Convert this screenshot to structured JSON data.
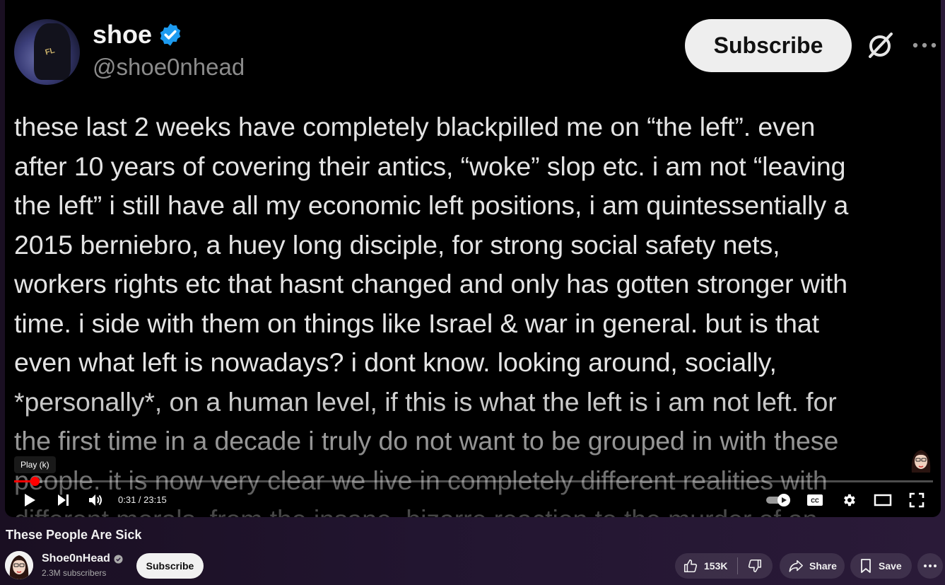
{
  "tweet": {
    "display_name": "shoe",
    "handle": "@shoe0nhead",
    "subscribe_label": "Subscribe",
    "lines": [
      "these last 2 weeks have completely blackpilled me on “the left”. even",
      "after 10 years of covering their antics, “woke” slop etc. i am not “leaving",
      "the left” i still have all my economic left positions, i am quintessentially a",
      "2015 berniebro, a huey long disciple, for strong social safety nets,",
      "workers rights etc that hasnt changed and only has gotten stronger with",
      "time. i side with them on things like Israel & war in general. but is that",
      "even what left is nowadays? i dont know. looking around, socially,",
      "*personally*, on a human level, if this is what the left is i am not left. for",
      "the first time in a decade i truly do not want to be grouped in with these",
      "people. it is now very clear we live in completely different realities with",
      "different morals, from the insane, bizarre reaction to the murder of an"
    ]
  },
  "player": {
    "tooltip": "Play (k)",
    "time_display": "0:31 / 23:15",
    "progress_fraction": 0.022
  },
  "video": {
    "title": "These People Are Sick"
  },
  "channel": {
    "name": "Shoe0nHead",
    "subscribers": "2.3M subscribers",
    "subscribe_label": "Subscribe"
  },
  "actions": {
    "likes": "153K",
    "share_label": "Share",
    "save_label": "Save"
  },
  "colors": {
    "accent": "#ff0000",
    "verified": "#1d9bf0"
  },
  "icons": [
    "verified-icon",
    "grok-icon",
    "more-icon",
    "play-icon",
    "next-icon",
    "volume-icon",
    "autoplay-toggle",
    "captions-icon",
    "settings-icon",
    "theater-icon",
    "fullscreen-icon",
    "like-icon",
    "dislike-icon",
    "share-icon",
    "save-icon"
  ]
}
